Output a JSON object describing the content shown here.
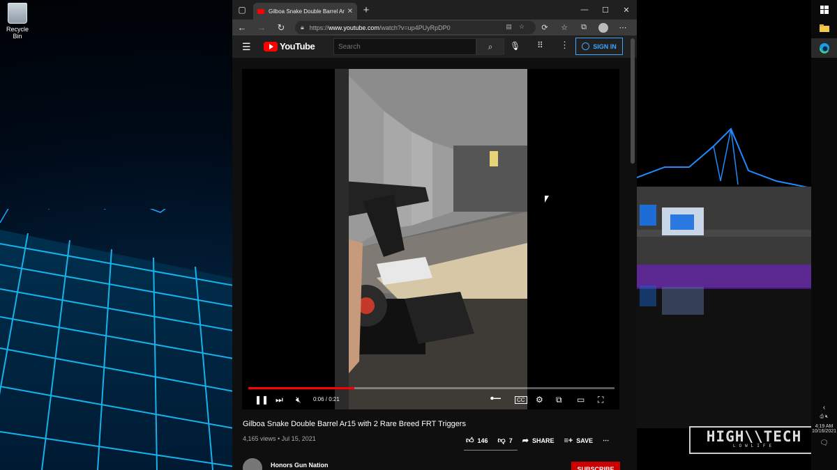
{
  "desktop": {
    "recycle_bin_label": "Recycle Bin",
    "watermark_main": "HIGH\\\\TECH",
    "watermark_sub": "LOWLIFE"
  },
  "browser": {
    "tab_title": "Gilboa Snake Double Barrel Ar15",
    "url_scheme": "https://",
    "url_host": "www.youtube.com",
    "url_path": "/watch?v=up4PUyRpDP0"
  },
  "youtube": {
    "logo_text": "YouTube",
    "search_placeholder": "Search",
    "sign_in_label": "SIGN IN",
    "player": {
      "time": "0:06 / 0:21",
      "progress_fraction": 0.29
    },
    "video": {
      "title": "Gilboa Snake Double Barrel Ar15 with 2 Rare Breed FRT Triggers",
      "meta": "4,165 views • Jul 15, 2021",
      "likes": "146",
      "dislikes": "7",
      "share_label": "SHARE",
      "save_label": "SAVE"
    },
    "channel": {
      "name": "Honors Gun Nation",
      "subscribe_label": "SUBSCRIBE"
    }
  },
  "taskbar": {
    "time": "4:19 AM",
    "date": "10/16/2021"
  },
  "colors": {
    "yt_red": "#ff0000",
    "link_blue": "#3ea6ff",
    "neon_cyan": "#00c8ff"
  }
}
